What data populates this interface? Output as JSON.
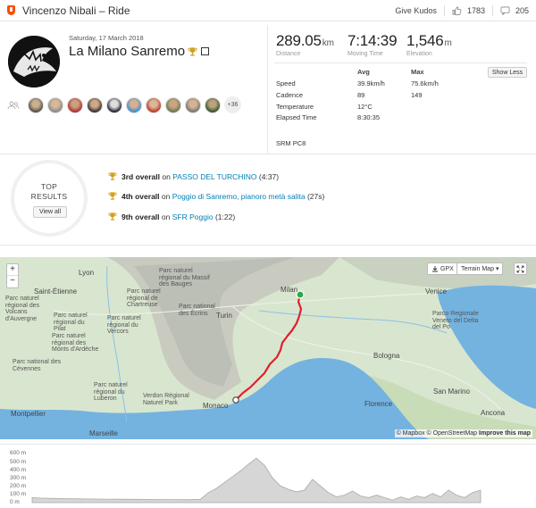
{
  "header": {
    "title": "Vincenzo Nibali – Ride",
    "give_kudos": "Give Kudos",
    "kudos_count": "1783",
    "comment_count": "205"
  },
  "activity": {
    "date": "Saturday, 17 March 2018",
    "name": "La Milano Sanremo",
    "more_athletes": "+36"
  },
  "stats": {
    "distance": {
      "value": "289.05",
      "unit": "km",
      "label": "Distance"
    },
    "moving_time": {
      "value": "7:14:39",
      "label": "Moving Time"
    },
    "elevation": {
      "value": "1,546",
      "unit": "m",
      "label": "Elevation"
    },
    "col_avg": "Avg",
    "col_max": "Max",
    "rows": [
      {
        "label": "Speed",
        "avg": "39.9km/h",
        "max": "75.6km/h"
      },
      {
        "label": "Cadence",
        "avg": "89",
        "max": "149"
      },
      {
        "label": "Temperature",
        "avg": "12°C",
        "max": ""
      },
      {
        "label": "Elapsed Time",
        "avg": "8:30:35",
        "max": ""
      }
    ],
    "show_less": "Show Less",
    "device": "SRM PC8"
  },
  "top_results": {
    "heading_line1": "TOP",
    "heading_line2": "RESULTS",
    "view_all": "View all",
    "on": "on",
    "items": [
      {
        "rank": "3rd overall",
        "segment": "PASSO DEL TURCHINO",
        "time": "(4:37)"
      },
      {
        "rank": "4th overall",
        "segment": "Poggio di Sanremo, pianoro metà salita",
        "time": "(27s)"
      },
      {
        "rank": "9th overall",
        "segment": "SFR Poggio",
        "time": "(1:22)"
      }
    ]
  },
  "map": {
    "zoom_in": "+",
    "zoom_out": "−",
    "gpx": "GPX",
    "terrain": "Terrain Map",
    "attribution_mapbox": "© Mapbox",
    "attribution_osm": "© OpenStreetMap",
    "improve": "Improve this map",
    "labels": {
      "lyon": "Lyon",
      "saint_etienne": "Saint-Étienne",
      "auvergne": "Parc naturel régional des Volcans d'Auvergne",
      "massif_bauges": "Parc naturel régional du Massif des Bauges",
      "chartreuse": "Parc naturel régional de Chartreuse",
      "vercors": "Parc naturel régional du Vercors",
      "ecrins": "Parc national des Écrins",
      "pilat": "Parc naturel régional du Pilat",
      "monts_ardeche": "Parc naturel régional des Monts d'Ardèche",
      "cevennes": "Parc national des Cévennes",
      "luberon": "Parc naturel régional du Luberon",
      "verdon": "Verdon Régional Naturel Park",
      "montpellier": "Montpellier",
      "marseille": "Marseille",
      "monaco": "Monaco",
      "turin": "Turin",
      "milan": "Milan",
      "venice": "Venice",
      "po_delta": "Parco Regionale Veneto del Delta del Po",
      "bologna": "Bologna",
      "florence": "Florence",
      "san_marino": "San Marino",
      "ancona": "Ancona"
    }
  },
  "elevation_chart": {
    "y_ticks": [
      "600 m",
      "500 m",
      "400 m",
      "300 m",
      "200 m",
      "100 m",
      "0 m"
    ],
    "profile": [
      60,
      55,
      52,
      50,
      48,
      46,
      45,
      44,
      43,
      42,
      42,
      41,
      40,
      40,
      39,
      38,
      37,
      36,
      36,
      35,
      35,
      40,
      120,
      170,
      240,
      310,
      380,
      460,
      535,
      450,
      300,
      200,
      160,
      130,
      150,
      280,
      200,
      120,
      70,
      90,
      140,
      80,
      60,
      90,
      60,
      30,
      70,
      40,
      80,
      60,
      110,
      70,
      150,
      90,
      60,
      120,
      150
    ]
  },
  "colors": {
    "brand": "#fc4c02",
    "link": "#007fb6",
    "route": "#e0202a",
    "sea": "#74b3e0",
    "land": "#d9e6cf"
  }
}
